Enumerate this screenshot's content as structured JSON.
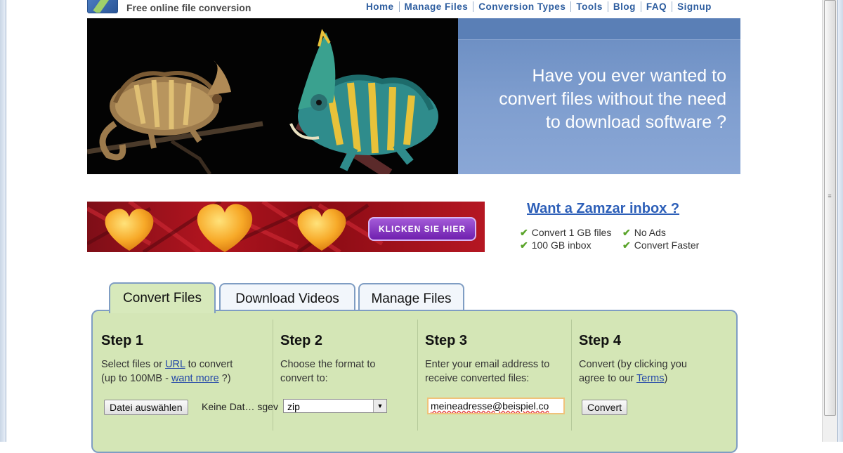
{
  "header": {
    "tagline": "Free online file conversion",
    "nav": [
      "Home",
      "Manage Files",
      "Conversion Types",
      "Tools",
      "Blog",
      "FAQ",
      "Signup"
    ]
  },
  "hero": {
    "lines": [
      "Have you ever wanted to",
      "convert files without the need",
      "to download software ?"
    ]
  },
  "ad": {
    "button_label": "KLICKEN SIE HIER"
  },
  "promo": {
    "title": "Want a Zamzar inbox ?",
    "features": [
      "Convert 1 GB files",
      "No Ads",
      "100 GB inbox",
      "Convert Faster"
    ]
  },
  "tabs": [
    "Convert Files",
    "Download Videos",
    "Manage Files"
  ],
  "steps": {
    "s1": {
      "title": "Step 1",
      "desc_a": "Select files or ",
      "desc_link1": "URL",
      "desc_b": " to convert",
      "desc_c": "(up to 100MB - ",
      "desc_link2": "want more",
      "desc_d": " ?)",
      "file_button": "Datei auswählen",
      "file_status": "Keine Dat… sgev"
    },
    "s2": {
      "title": "Step 2",
      "desc_a": "Choose the format to",
      "desc_b": "convert to:",
      "format_value": "zip"
    },
    "s3": {
      "title": "Step 3",
      "desc_a": "Enter your email address to",
      "desc_b": "receive converted files:",
      "email_value": "meineadresse@beispiel.co"
    },
    "s4": {
      "title": "Step 4",
      "desc_a": "Convert (by clicking you",
      "desc_b": "agree to our ",
      "desc_link": "Terms",
      "desc_c": ")",
      "convert_button": "Convert"
    }
  },
  "colors": {
    "nav_link": "#2d5d9f",
    "panel_bg": "#d4e6b6",
    "hero_panel": "#7f9ecf",
    "ad_bg": "#b0141f",
    "check": "#5aa42a"
  }
}
